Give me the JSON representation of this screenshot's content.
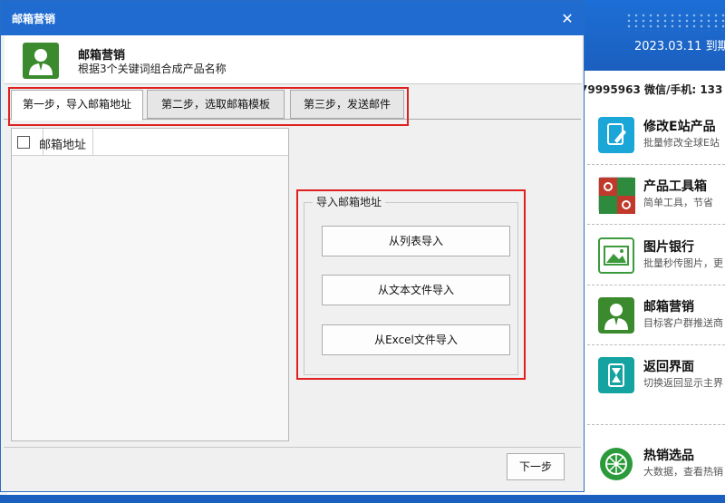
{
  "background_app": {
    "expire_text": "2023.03.11 到期",
    "contact_text": "79995963 微信/手机: 133",
    "tools": [
      {
        "name": "修改E站产品",
        "desc": "批量修改全球E站",
        "icon": "edit-document-icon",
        "color": "#1aa6d6"
      },
      {
        "name": "产品工具箱",
        "desc": "简单工具，节省",
        "icon": "link-toolbox-icon",
        "color": "#c0392b"
      },
      {
        "name": "图片银行",
        "desc": "批量秒传图片，更",
        "icon": "image-bank-icon",
        "color": "#3c9a3c"
      },
      {
        "name": "邮箱营销",
        "desc": "目标客户群推送商",
        "icon": "user-mail-icon",
        "color": "#3c8a2e"
      },
      {
        "name": "返回界面",
        "desc": "切换返回显示主界",
        "icon": "hourglass-icon",
        "color": "#14a3a0"
      },
      {
        "name": "热销选品",
        "desc": "大数据，查看热销",
        "icon": "hot-product-icon",
        "color": "#2a9a3a"
      }
    ]
  },
  "dialog": {
    "title": "邮箱营销",
    "close_glyph": "✕",
    "header": {
      "title": "邮箱营销",
      "subtitle": "根据3个关键词组合成产品名称"
    },
    "tabs": [
      {
        "label": "第一步，导入邮箱地址",
        "active": true
      },
      {
        "label": "第二步，选取邮箱模板",
        "active": false
      },
      {
        "label": "第三步，发送邮件",
        "active": false
      }
    ],
    "grid": {
      "column": "邮箱地址"
    },
    "import_group": {
      "legend": "导入邮箱地址",
      "buttons": [
        "从列表导入",
        "从文本文件导入",
        "从Excel文件导入"
      ]
    },
    "next_button": "下一步"
  },
  "colors": {
    "titlebar": "#1f6bd0",
    "highlight_outline": "#e02020",
    "dialog_bg": "#f0f0f0"
  }
}
